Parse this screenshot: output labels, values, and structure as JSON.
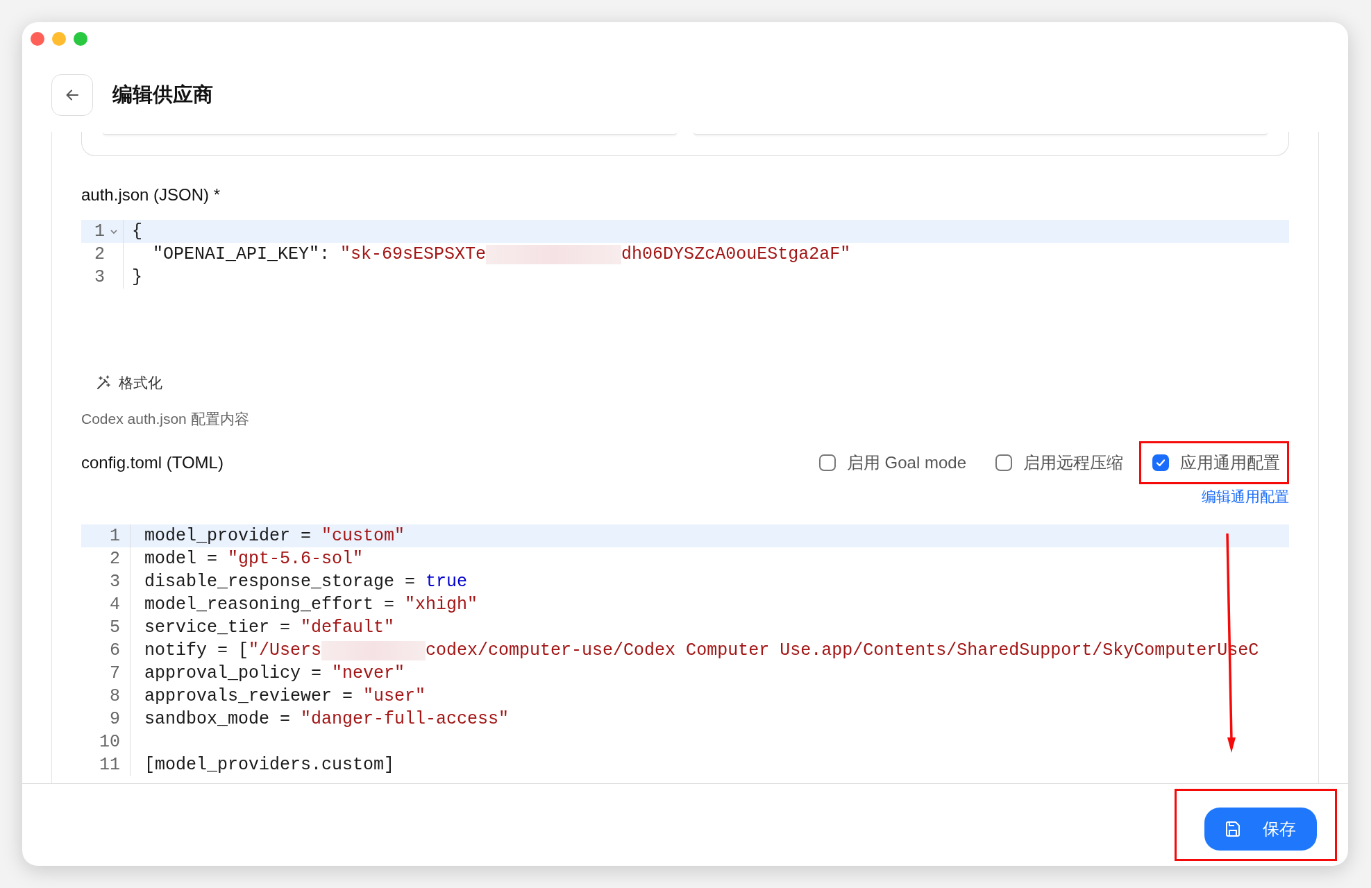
{
  "header": {
    "title": "编辑供应商"
  },
  "auth": {
    "label": "auth.json (JSON) *",
    "editor": {
      "lines": [
        {
          "number": "1",
          "fold": true,
          "active": true,
          "tokens": [
            {
              "kind": "plain",
              "text": "{"
            }
          ]
        },
        {
          "number": "2",
          "fold": false,
          "active": false,
          "tokens": [
            {
              "kind": "plain",
              "text": "  \"OPENAI_API_KEY\": "
            },
            {
              "kind": "string",
              "text": "\"sk-69sESPSXTe"
            },
            {
              "kind": "redacted"
            },
            {
              "kind": "string",
              "text": "dh06DYSZcA0ouEStga2aF\""
            }
          ]
        },
        {
          "number": "3",
          "fold": false,
          "active": false,
          "tokens": [
            {
              "kind": "plain",
              "text": "}"
            }
          ]
        }
      ]
    },
    "format_button": "格式化",
    "help": "Codex auth.json 配置内容"
  },
  "config": {
    "label": "config.toml (TOML)",
    "options": [
      {
        "label": "启用 Goal mode",
        "checked": false,
        "highlighted": false
      },
      {
        "label": "启用远程压缩",
        "checked": false,
        "highlighted": false
      },
      {
        "label": "应用通用配置",
        "checked": true,
        "highlighted": true
      }
    ],
    "edit_link": "编辑通用配置",
    "editor": {
      "lines": [
        {
          "number": "1",
          "active": true,
          "tokens": [
            {
              "kind": "plain",
              "text": "model_provider = "
            },
            {
              "kind": "string",
              "text": "\"custom\""
            }
          ]
        },
        {
          "number": "2",
          "active": false,
          "tokens": [
            {
              "kind": "plain",
              "text": "model = "
            },
            {
              "kind": "string",
              "text": "\"gpt-5.6-sol\""
            }
          ]
        },
        {
          "number": "3",
          "active": false,
          "tokens": [
            {
              "kind": "plain",
              "text": "disable_response_storage = "
            },
            {
              "kind": "keyword",
              "text": "true"
            }
          ]
        },
        {
          "number": "4",
          "active": false,
          "tokens": [
            {
              "kind": "plain",
              "text": "model_reasoning_effort = "
            },
            {
              "kind": "string",
              "text": "\"xhigh\""
            }
          ]
        },
        {
          "number": "5",
          "active": false,
          "tokens": [
            {
              "kind": "plain",
              "text": "service_tier = "
            },
            {
              "kind": "string",
              "text": "\"default\""
            }
          ]
        },
        {
          "number": "6",
          "active": false,
          "tokens": [
            {
              "kind": "plain",
              "text": "notify = ["
            },
            {
              "kind": "string",
              "text": "\"/Users"
            },
            {
              "kind": "redacted"
            },
            {
              "kind": "string",
              "text": "codex/computer-use/Codex Computer Use.app/Contents/SharedSupport/SkyComputerUseC"
            }
          ]
        },
        {
          "number": "7",
          "active": false,
          "tokens": [
            {
              "kind": "plain",
              "text": "approval_policy = "
            },
            {
              "kind": "string",
              "text": "\"never\""
            }
          ]
        },
        {
          "number": "8",
          "active": false,
          "tokens": [
            {
              "kind": "plain",
              "text": "approvals_reviewer = "
            },
            {
              "kind": "string",
              "text": "\"user\""
            }
          ]
        },
        {
          "number": "9",
          "active": false,
          "tokens": [
            {
              "kind": "plain",
              "text": "sandbox_mode = "
            },
            {
              "kind": "string",
              "text": "\"danger-full-access\""
            }
          ]
        },
        {
          "number": "10",
          "active": false
        },
        {
          "number": "11",
          "active": false,
          "tokens": [
            {
              "kind": "plain",
              "text": "[model_providers.custom]"
            }
          ]
        }
      ]
    }
  },
  "footer": {
    "save_button": "保存",
    "highlighted": true
  },
  "annotations": [
    {
      "kind": "arrow"
    }
  ]
}
